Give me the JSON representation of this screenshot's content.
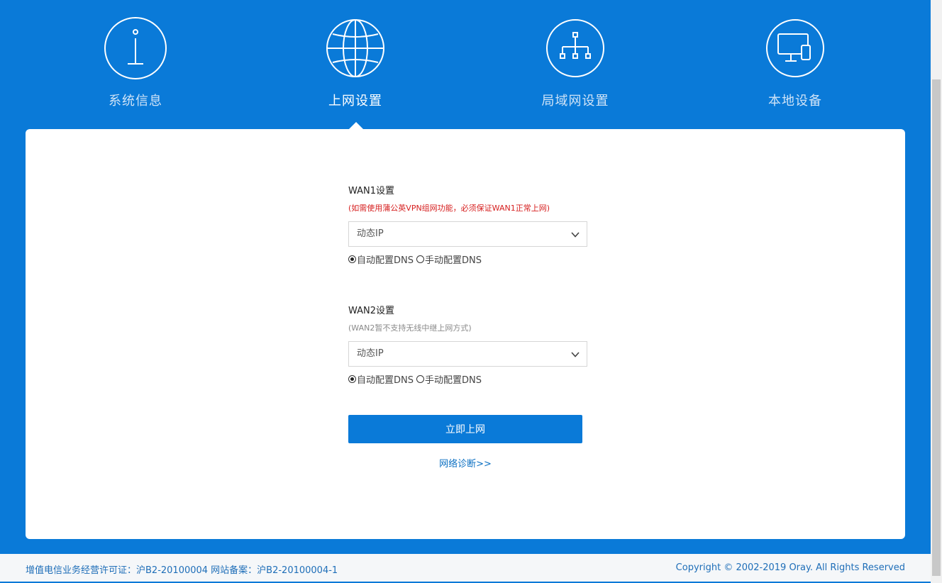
{
  "nav": [
    {
      "label": "系统信息",
      "icon": "info-icon",
      "active": false
    },
    {
      "label": "上网设置",
      "icon": "globe-icon",
      "active": true
    },
    {
      "label": "局域网设置",
      "icon": "network-topology-icon",
      "active": false
    },
    {
      "label": "本地设备",
      "icon": "devices-icon",
      "active": false
    }
  ],
  "wan1": {
    "title": "WAN1设置",
    "hint": "(如需使用蒲公英VPN组网功能，必须保证WAN1正常上网)",
    "mode": "动态IP",
    "dns_auto": "自动配置DNS",
    "dns_manual": "手动配置DNS",
    "dns_selected": "auto"
  },
  "wan2": {
    "title": "WAN2设置",
    "hint": "(WAN2暂不支持无线中继上网方式)",
    "mode": "动态IP",
    "dns_auto": "自动配置DNS",
    "dns_manual": "手动配置DNS",
    "dns_selected": "auto"
  },
  "actions": {
    "submit": "立即上网",
    "diagnose": "网络诊断>>"
  },
  "footer": {
    "license": "增值电信业务经营许可证：沪B2-20100004 网站备案：沪B2-20100004-1",
    "copyright": "Copyright © 2002-2019 Oray. All Rights Reserved"
  },
  "colors": {
    "primary": "#0a7ad8",
    "hint_red": "#d61f1f",
    "link": "#0a6fc2"
  }
}
